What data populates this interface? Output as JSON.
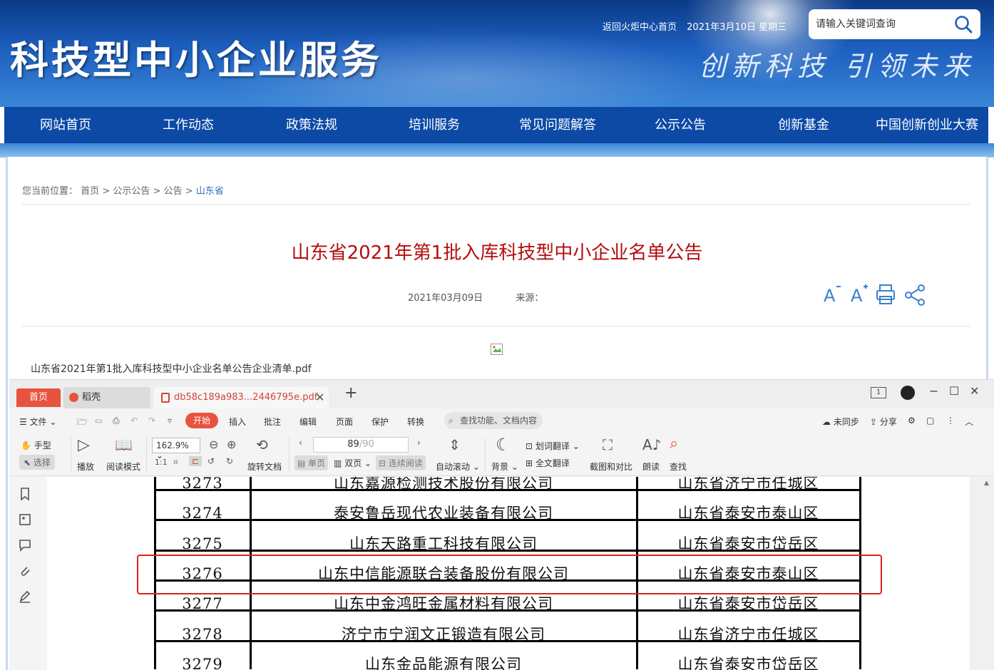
{
  "site": {
    "title": "科技型中小企业服务",
    "slogan": "创新科技  引领未来",
    "top_links": [
      "返回火炬中心首页",
      "2021年3月10日 星期三"
    ],
    "search_placeholder": "请输入关键词查询"
  },
  "nav": [
    "网站首页",
    "工作动态",
    "政策法规",
    "培训服务",
    "常见问题解答",
    "公示公告",
    "创新基金",
    "中国创新创业大赛"
  ],
  "breadcrumb": {
    "prefix": "您当前位置：",
    "items": [
      "首页",
      "公示公告",
      "公告"
    ],
    "current": "山东省",
    "sep": ">"
  },
  "article": {
    "title": "山东省2021年第1批入库科技型中小企业名单公告",
    "date": "2021年03月09日",
    "source": "来源：",
    "attachment": "山东省2021年第1批入库科技型中小企业名单公告企业清单.pdf"
  },
  "app": {
    "tabs": [
      "首页",
      "稻壳",
      "db58c189a983...2446795e.pdf"
    ],
    "menu": [
      "文件",
      "开始",
      "插入",
      "批注",
      "编辑",
      "页面",
      "保护",
      "转换"
    ],
    "menu_search": "查找功能、文档内容",
    "right_menu": [
      "未同步",
      "分享"
    ],
    "toolbar": {
      "hand": "手型",
      "select": "选择",
      "play": "播放",
      "read_mode": "阅读模式",
      "zoom": "162.9%",
      "rotate": "旋转文档",
      "page_current": "89",
      "page_total": "/90",
      "single": "单页",
      "double": "双页",
      "continuous": "连续阅读",
      "auto_scroll": "自动滚动",
      "background": "背景",
      "word_translate": "划词翻译",
      "full_translate": "全文翻译",
      "screenshot": "截图和对比",
      "read_aloud": "朗读",
      "find": "查找"
    }
  },
  "table_rows": [
    {
      "no": "3273",
      "name": "山东嘉源检测技术股份有限公司",
      "region": "山东省济宁市任城区"
    },
    {
      "no": "3274",
      "name": "泰安鲁岳现代农业装备有限公司",
      "region": "山东省泰安市泰山区"
    },
    {
      "no": "3275",
      "name": "山东天路重工科技有限公司",
      "region": "山东省泰安市岱岳区"
    },
    {
      "no": "3276",
      "name": "山东中信能源联合装备股份有限公司",
      "region": "山东省泰安市泰山区"
    },
    {
      "no": "3277",
      "name": "山东中金鸿旺金属材料有限公司",
      "region": "山东省泰安市岱岳区"
    },
    {
      "no": "3278",
      "name": "济宁市宁润文正锻造有限公司",
      "region": "山东省济宁市任城区"
    },
    {
      "no": "3279",
      "name": "山东金品能源有限公司",
      "region": "山东省泰安市岱岳区"
    }
  ],
  "colors": {
    "nav": "#0c4aa6",
    "title_red": "#b50d0d",
    "accent": "#e8533f",
    "highlight": "#e02020"
  }
}
